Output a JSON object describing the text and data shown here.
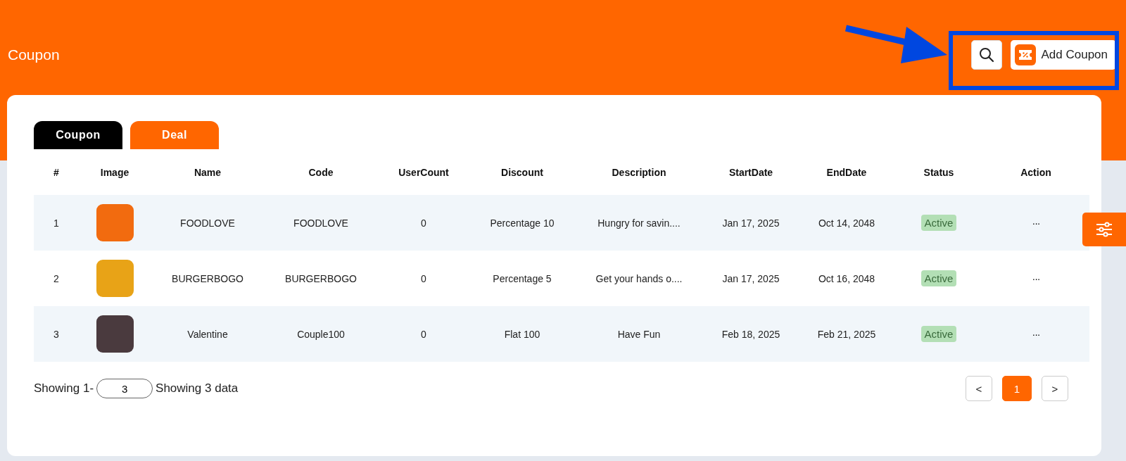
{
  "header": {
    "title": "Coupon",
    "add_button": "Add Coupon"
  },
  "tabs": [
    {
      "label": "Coupon",
      "selected": true
    },
    {
      "label": "Deal",
      "selected": false
    }
  ],
  "table": {
    "columns": [
      "#",
      "Image",
      "Name",
      "Code",
      "UserCount",
      "Discount",
      "Description",
      "StartDate",
      "EndDate",
      "Status",
      "Action"
    ],
    "rows": [
      {
        "index": "1",
        "name": "FOODLOVE",
        "code": "FOODLOVE",
        "user_count": "0",
        "discount": "Percentage 10",
        "description": "Hungry for savin....",
        "start_date": "Jan 17, 2025",
        "end_date": "Oct 14, 2048",
        "status": "Active",
        "action": "···"
      },
      {
        "index": "2",
        "name": "BURGERBOGO",
        "code": "BURGERBOGO",
        "user_count": "0",
        "discount": "Percentage 5",
        "description": "Get your hands o....",
        "start_date": "Jan 17, 2025",
        "end_date": "Oct 16, 2048",
        "status": "Active",
        "action": "···"
      },
      {
        "index": "3",
        "name": "Valentine",
        "code": "Couple100",
        "user_count": "0",
        "discount": "Flat 100",
        "description": "Have Fun",
        "start_date": "Feb 18, 2025",
        "end_date": "Feb 21, 2025",
        "status": "Active",
        "action": "···"
      }
    ]
  },
  "footer": {
    "showing_prefix": "Showing 1-",
    "page_size": "3",
    "showing_total": "Showing 3 data"
  },
  "pagination": {
    "prev": "<",
    "pages": [
      {
        "label": "1",
        "selected": true
      }
    ],
    "next": ">"
  }
}
